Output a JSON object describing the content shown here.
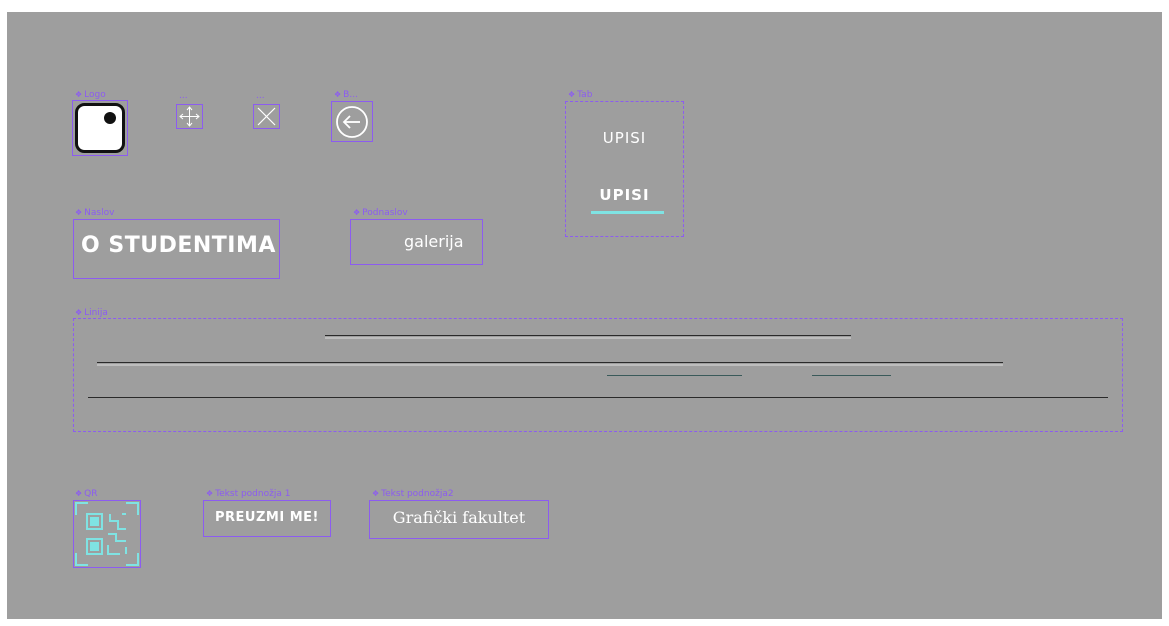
{
  "components": {
    "logo": {
      "label": "Logo"
    },
    "move": {
      "label": "..."
    },
    "close": {
      "label": "..."
    },
    "back": {
      "label": "B..."
    },
    "tab": {
      "label": "Tab",
      "tab_normal": "UPISI",
      "tab_active": "UPISI"
    },
    "naslov": {
      "label": "Naslov",
      "text": "O STUDENTIMA"
    },
    "podnaslov": {
      "label": "Podnaslov",
      "text": "galerija"
    },
    "linija": {
      "label": "Linija"
    },
    "qr": {
      "label": "QR"
    },
    "footer1": {
      "label": "Tekst podnožja 1",
      "text": "PREUZMI ME!"
    },
    "footer2": {
      "label": "Tekst podnožja2",
      "text": "Grafički fakultet"
    }
  },
  "icons": [
    "logo-icon",
    "move-arrows-icon",
    "close-x-icon",
    "back-arrow-icon",
    "qr-code-icon"
  ],
  "colors": {
    "canvas": "#9e9e9e",
    "frame": "#8c5cf0",
    "accent": "#7fe3e3",
    "text": "#ffffff"
  }
}
